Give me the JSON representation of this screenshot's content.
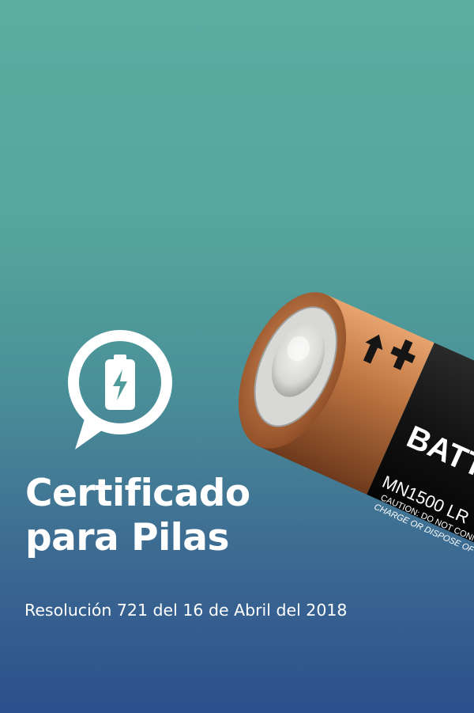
{
  "poster": {
    "title_line1": "Certificado",
    "title_line2": "para Pilas",
    "subtitle": "Resolución 721 del 16 de Abril del 2018"
  },
  "battery_label": {
    "brand_text": "BATTE",
    "model_text": "MN1500 LR",
    "caution_line1": "CAUTION: DO NOT CONN",
    "caution_line2": "CHARGE OR DISPOSE OF IN"
  },
  "icons": [
    "chat-bubble-battery-icon",
    "lightning-icon"
  ],
  "colors": {
    "background_top": "#5aaea0",
    "background_bottom": "#2c4f8c",
    "battery_copper": "#c47a45",
    "battery_label": "#141414",
    "text": "#ffffff"
  }
}
